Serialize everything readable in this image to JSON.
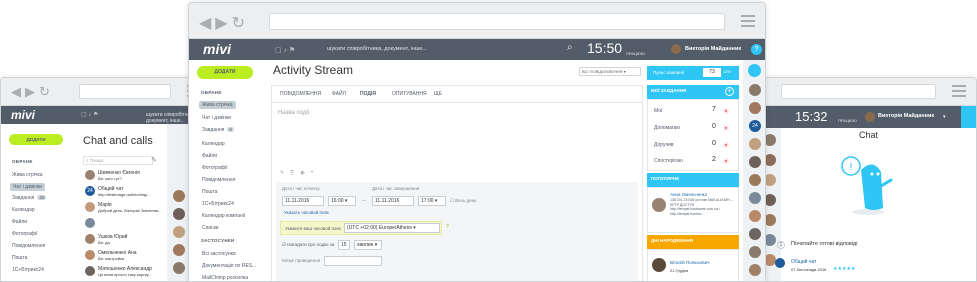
{
  "left_window": {
    "add_label": "ДОДАТИ",
    "page_title": "Chat and calls",
    "search_placeholder": "Пошук",
    "topbar_search": "шукати співробітника, документ, інше...",
    "sidebar_heading": "ОБРАНЕ",
    "sidebar_items": [
      "Жива стрічка",
      "Чат і дзвінки",
      "Завдання",
      "Календар",
      "Файли",
      "Фотографії",
      "Повідомлення",
      "Пошта",
      "1С+Бітрикс24"
    ],
    "tasks_badge": "26",
    "chats": [
      {
        "name": "Шевченко Євгенія",
        "text": "Ви: кого тут?"
      },
      {
        "name": "Общий чат",
        "text": "http://testimage.ua/foto/img/..."
      },
      {
        "name": "Марія",
        "text": "Добрий день, Вікторія! Змінення..."
      },
      {
        "name": "",
        "text": ""
      },
      {
        "name": "Ушков Юрий",
        "text": "Ви: да"
      },
      {
        "name": "Омельченко Ана",
        "text": "Ви: настройка"
      },
      {
        "name": "Матюшенко Александр",
        "text": "Це вона просто таку картку..."
      }
    ],
    "chat_24": "24"
  },
  "center_window": {
    "add_label": "ДОДАТИ",
    "page_title": "Activity Stream",
    "filter_label": "ВСІ ПОВІДОМЛЕННЯ",
    "topbar_search": "шукати співробітника, документ, інше...",
    "clock": "15:50",
    "status": "ПРАЦЮЮ",
    "user_name": "Викторія Майданник",
    "sidebar_heading": "ОБРАНЕ",
    "sidebar_items": [
      "Жива стрічка",
      "Чат і дзвінки",
      "Завдання",
      "Календар",
      "Файли",
      "Фотографії",
      "Повідомлення",
      "Пошта",
      "1С+Бітрикс24",
      "Календар компанії",
      "Списки"
    ],
    "tasks_badge": "6",
    "sidebar_heading2": "ЗАСТОСУНКИ",
    "sidebar_items2": [
      "Всі застосунки",
      "Документація по RES...",
      "MailChimp розсилка"
    ],
    "tabs": [
      "ПОВІДОМЛЕННЯ",
      "ФАЙЛ",
      "ПОДІЯ",
      "ОПИТУВАННЯ",
      "ЩЕ"
    ],
    "event_placeholder": "Назва події",
    "start_label": "Дата і час початку",
    "end_label": "Дата і час завершення",
    "start_date": "11.11.2016",
    "start_time": "16:00",
    "end_date": "11.11.2016",
    "end_time": "17:00",
    "all_day": "Весь день",
    "timezone_link": "Указать часовой пояс",
    "timezone_label": "Укажите ваш часовой пояс",
    "timezone_value": "(UTC +02:00) Europe/Athens",
    "remind_label": "Нагадати про подію за",
    "remind_value": "15",
    "remind_unit": "хвилин",
    "place_label": "Місце проведення",
    "pulse_label": "Пульс компанії",
    "pulse_value": "73",
    "pulse_percent": "12%",
    "tasks_header": "МОЇ ЗАВДАННЯ",
    "tasks": [
      {
        "label": "Мої",
        "count": "7"
      },
      {
        "label": "Допомагаю",
        "count": "0"
      },
      {
        "label": "Доручив",
        "count": "0"
      },
      {
        "label": "Спостерігаю",
        "count": "2"
      }
    ],
    "birthdays_header": "ПОПУЛЯРНЕ",
    "popular_name": "Анна Омельченко",
    "popular_text": "138.201.219.66 усі нові MAKALAЧИН – SFTP ДОСТУП http://tempal.hostname.com.ua / http://tempal.hostna...",
    "birthdays_header2": "ДНІ НАРОДЖЕННЯ",
    "birthday_name": "Віталій Полюхович",
    "birthday_date": "21 Грудня",
    "badge_24": "24"
  },
  "right_window": {
    "clock": "15:32",
    "status": "ПРАЦЮЮ",
    "user_name": "Викторія Майданник",
    "chat_title": "Chat",
    "hint_title": "Почитайте готові відповіді",
    "hint_number": "1",
    "chat_link": "Общий чат",
    "chat_date": "07 Листопада 2016"
  },
  "colors": {
    "topbar": "#535c69",
    "accent_green": "#bbed21",
    "accent_blue": "#2fc6f6",
    "orange": "#f7a700"
  }
}
